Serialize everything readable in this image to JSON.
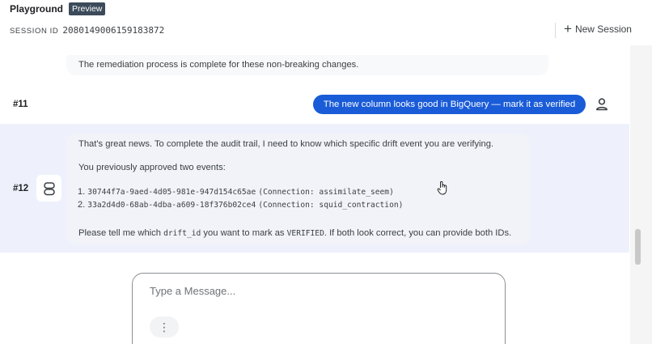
{
  "header": {
    "app_title": "Playground",
    "badge": "Preview",
    "session_label": "SESSION ID",
    "session_id": "2080149006159183872",
    "new_session_label": "New Session"
  },
  "messages": {
    "previous_text": "The remediation process is complete for these non-breaking changes.",
    "turn_11": {
      "label": "#11",
      "user_text": "The new column looks good in BigQuery — mark it as verified"
    },
    "turn_12": {
      "label": "#12",
      "para1": "That's great news. To complete the audit trail, I need to know which specific drift event you are verifying.",
      "para2": "You previously approved two events:",
      "events": [
        {
          "number": "1.",
          "id": "30744f7a-9aed-4d05-981e-947d154c65ae",
          "connection": "(Connection: assimilate_seem)"
        },
        {
          "number": "2.",
          "id": "33a2d4d0-68ab-4dba-a609-18f376b02ce4",
          "connection": "(Connection: squid_contraction)"
        }
      ],
      "closing_pre": "Please tell me which",
      "closing_code_1": "drift_id",
      "closing_mid": "you want to mark as",
      "closing_code_2": "VERIFIED",
      "closing_post": ". If both look correct, you can provide both IDs."
    }
  },
  "composer": {
    "placeholder": "Type a Message...",
    "more_glyph": "⋮"
  },
  "icons": {
    "new_session": "plus-icon",
    "user": "person-icon",
    "bot": "agent-icon",
    "composer_more": "more-vert-icon"
  },
  "colors": {
    "user_bubble": "#1a5cd8",
    "turn_highlight": "#eef1fc",
    "badge": "#3c4a5a"
  }
}
